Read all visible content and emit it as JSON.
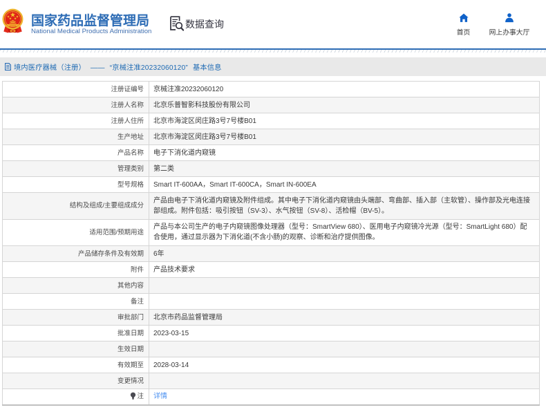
{
  "header": {
    "site_title_cn": "国家药品监督管理局",
    "site_title_en": "National Medical Products Administration",
    "section_label": "数据查询",
    "nav": [
      {
        "label": "首页",
        "icon": "home-icon"
      },
      {
        "label": "网上办事大厅",
        "icon": "user-icon"
      }
    ]
  },
  "breadcrumb": {
    "text": "境内医疗器械（注册） ——  “京械注准20232060120”  基本信息"
  },
  "table": {
    "rows": [
      {
        "label": "注册证编号",
        "value": "京械注准20232060120"
      },
      {
        "label": "注册人名称",
        "value": "北京乐普智影科技股份有限公司"
      },
      {
        "label": "注册人住所",
        "value": "北京市海淀区闵庄路3号7号楼B01"
      },
      {
        "label": "生产地址",
        "value": "北京市海淀区闵庄路3号7号楼B01"
      },
      {
        "label": "产品名称",
        "value": "电子下消化道内窥镜"
      },
      {
        "label": "管理类别",
        "value": "第二类"
      },
      {
        "label": "型号规格",
        "value": "Smart IT-600AA，Smart IT-600CA，Smart IN-600EA"
      },
      {
        "label": "结构及组成/主要组成成分",
        "value": "产品由电子下消化道内窥镜及附件组成。其中电子下消化道内窥镜由头端部、弯曲部、插入部（主软管）、操作部及光电连接部组成。附件包括：吸引按钮（SV-3）、水气按钮（SV-8）、活检帽（BV-5）。"
      },
      {
        "label": "适用范围/预期用途",
        "value": "产品与本公司生产的电子内窥镜图像处理器（型号：SmartView 680）、医用电子内窥镜冷光源（型号：SmartLight 680）配合使用，通过显示器为下消化道(不含小肠)的观察、诊断和治疗提供图像。"
      },
      {
        "label": "产品储存条件及有效期",
        "value": "6年"
      },
      {
        "label": "附件",
        "value": "产品技术要求"
      },
      {
        "label": "其他内容",
        "value": ""
      },
      {
        "label": "备注",
        "value": ""
      },
      {
        "label": "审批部门",
        "value": "北京市药品监督管理局"
      },
      {
        "label": "批准日期",
        "value": "2023-03-15"
      },
      {
        "label": "生效日期",
        "value": ""
      },
      {
        "label": "有效期至",
        "value": "2028-03-14"
      },
      {
        "label": "变更情况",
        "value": ""
      },
      {
        "label": "注",
        "value": "详情",
        "value_is_link": true,
        "label_icon": "bulb-icon"
      }
    ]
  },
  "colors": {
    "brand_blue": "#2d6cb5",
    "nav_icon_blue": "#1062c9",
    "link_blue": "#4a90f0",
    "crumb_bg": "#e9e9e9",
    "row_stripe": "#f5f5f5"
  }
}
